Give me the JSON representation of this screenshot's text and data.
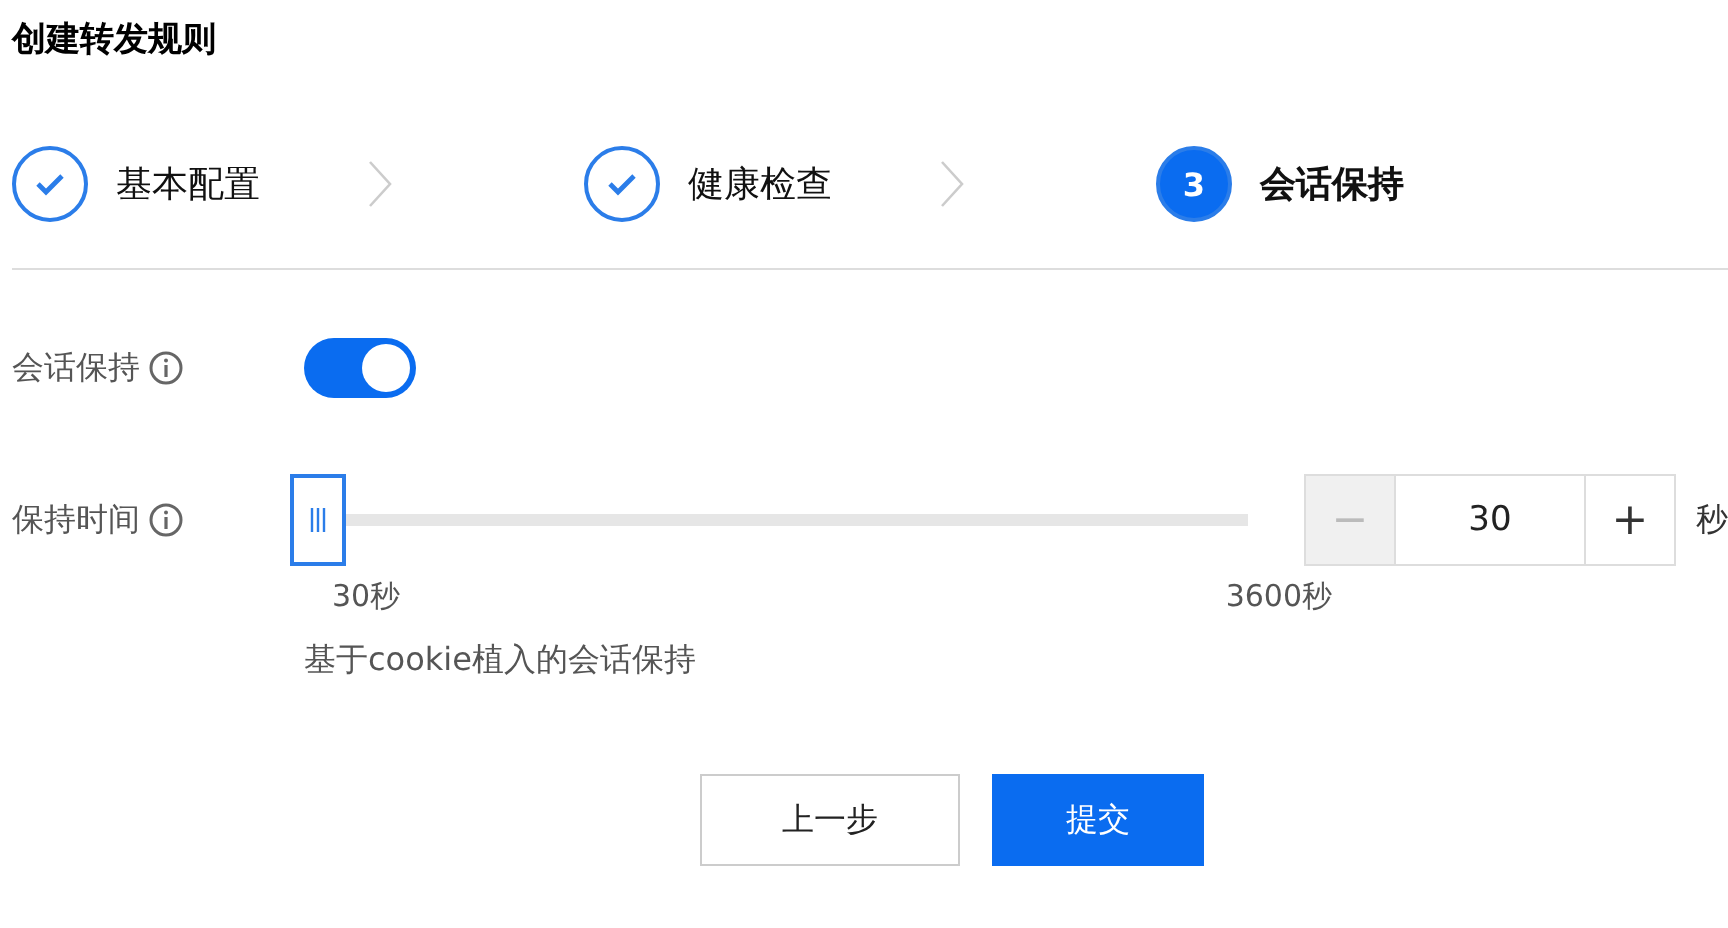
{
  "title": "创建转发规则",
  "steps": [
    {
      "label": "基本配置",
      "kind": "done"
    },
    {
      "label": "健康检查",
      "kind": "done"
    },
    {
      "label": "会话保持",
      "kind": "current",
      "number": "3"
    }
  ],
  "session_keep": {
    "label": "会话保持",
    "on": true
  },
  "keep_time": {
    "label": "保持时间",
    "level": 0,
    "min_label": "30秒",
    "max_label": "3600秒",
    "minus": "−",
    "value": "30",
    "plus": "+",
    "unit": "秒",
    "disabled_minus": true
  },
  "description": "基于cookie植入的会话保持",
  "buttons": [
    {
      "label": "上一步",
      "kind": "secondary"
    },
    {
      "label": "提交",
      "kind": "primary"
    }
  ]
}
